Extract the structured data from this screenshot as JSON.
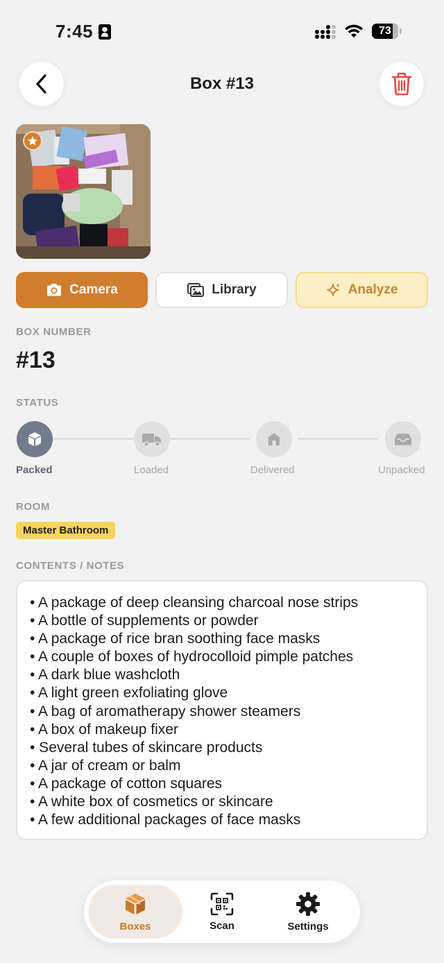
{
  "status_bar": {
    "time": "7:45",
    "battery": "73"
  },
  "header": {
    "title": "Box #13"
  },
  "actions": {
    "camera": "Camera",
    "library": "Library",
    "analyze": "Analyze"
  },
  "box_number": {
    "label": "BOX NUMBER",
    "value": "#13"
  },
  "status": {
    "label": "STATUS",
    "current": "Packed",
    "steps": [
      "Packed",
      "Loaded",
      "Delivered",
      "Unpacked"
    ]
  },
  "room": {
    "label": "ROOM",
    "value": "Master Bathroom"
  },
  "notes": {
    "label": "CONTENTS / NOTES",
    "lines": [
      "• A package of deep cleansing charcoal nose strips",
      "• A bottle of supplements or powder",
      "• A package of rice bran soothing face masks",
      "• A couple of boxes of hydrocolloid pimple patches",
      "• A dark blue washcloth",
      "• A light green exfoliating glove",
      "• A bag of aromatherapy shower steamers",
      "• A box of makeup fixer",
      "• Several tubes of skincare products",
      "• A jar of cream or balm",
      "• A package of cotton squares",
      "• A white box of cosmetics or skincare",
      "• A few additional packages of face masks"
    ]
  },
  "tabs": {
    "boxes": "Boxes",
    "scan": "Scan",
    "settings": "Settings"
  },
  "colors": {
    "accent": "#d07d2e",
    "danger": "#e5483d",
    "room_chip": "#f7d45c",
    "status_active": "#737a8d"
  }
}
